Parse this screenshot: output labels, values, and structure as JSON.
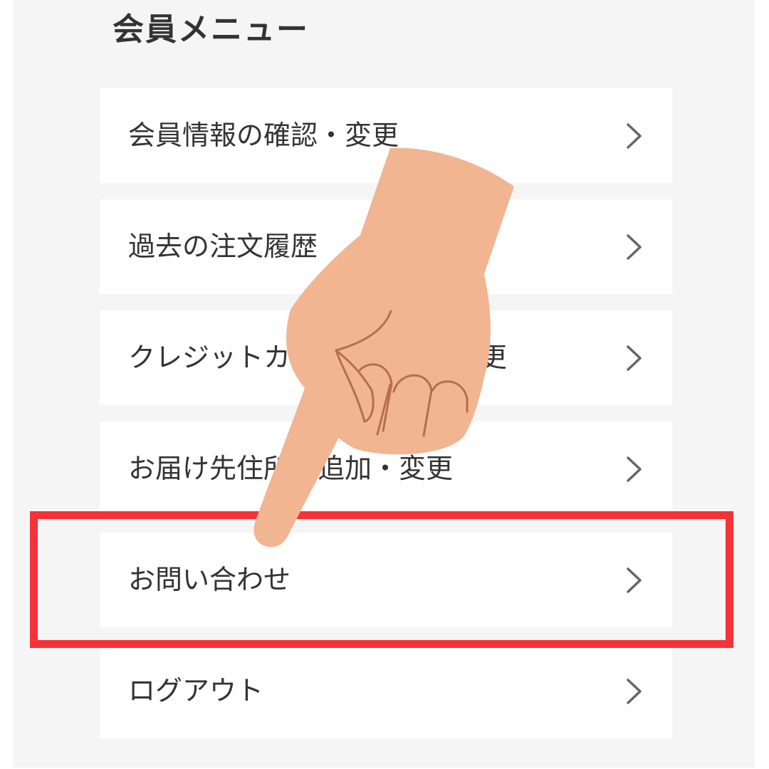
{
  "page": {
    "title": "会員メニュー"
  },
  "menu": {
    "items": [
      {
        "label": "会員情報の確認・変更",
        "icon": "chevron-right-icon"
      },
      {
        "label": "過去の注文履歴",
        "icon": "chevron-right-icon"
      },
      {
        "label": "クレジットカードの登録・変更",
        "icon": "chevron-right-icon"
      },
      {
        "label": "お届け先住所の追加・変更",
        "icon": "chevron-right-icon"
      },
      {
        "label": "お問い合わせ",
        "icon": "chevron-right-icon",
        "highlighted": true
      },
      {
        "label": "ログアウト",
        "icon": "chevron-right-icon"
      }
    ]
  },
  "colors": {
    "panel_background": "#f5f5f5",
    "item_background": "#ffffff",
    "text": "#333333",
    "chevron": "#666666",
    "highlight_border": "#f53238",
    "hand_skin": "#f1b592",
    "hand_outline": "#b86d4b"
  }
}
